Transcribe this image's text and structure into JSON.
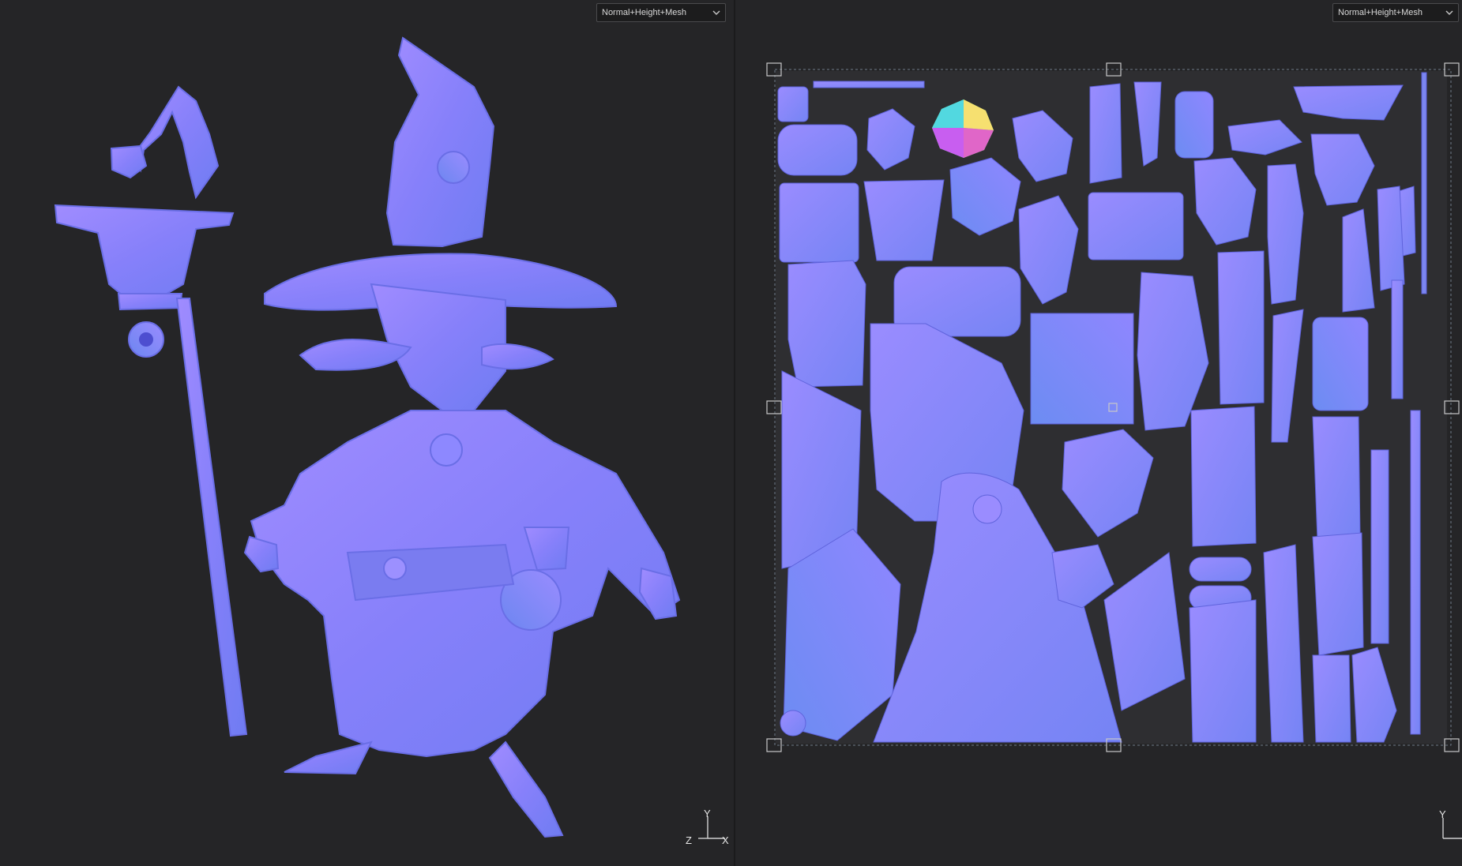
{
  "viewport_3d": {
    "display_mode": "Normal+Height+Mesh",
    "axes": {
      "y": "Y",
      "z": "Z",
      "x": "X"
    }
  },
  "viewport_2d": {
    "display_mode": "Normal+Height+Mesh",
    "axes": {
      "y": "Y"
    }
  },
  "icons": {
    "dropdown": "chevron-down-icon",
    "gizmo": "axis-gizmo-icon",
    "handle": "transform-handle-icon"
  },
  "colors": {
    "background": "#252527",
    "normal_map_base": "#8080ff",
    "mesh_tint": "#8a84f6",
    "selection_outline": "#6e7a8a"
  }
}
